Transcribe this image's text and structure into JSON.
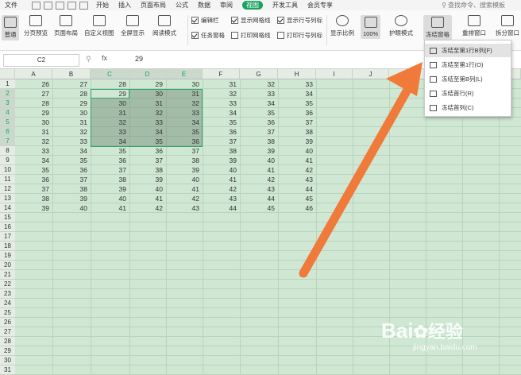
{
  "menubar": {
    "file_label": "文件",
    "tabs": [
      "开始",
      "插入",
      "页面布局",
      "公式",
      "数据",
      "审阅"
    ],
    "active_tab": "视图",
    "tabs_after": [
      "开发工具",
      "会员专享"
    ],
    "search_placeholder": "查找命令、搜索模板"
  },
  "ribbon": {
    "normal": "普通",
    "page_break_preview": "分页预览",
    "page_layout": "页面布局",
    "custom_view": "自定义视图",
    "full_screen": "全屏显示",
    "reading_mode": "阅读模式",
    "edit_bar": "编辑栏",
    "task_pane": "任务窗格",
    "show_gridlines": "显示网格线",
    "print_gridlines": "打印网格线",
    "show_headers": "显示行号列标",
    "print_headers": "打印行号列标",
    "zoom": "显示比例",
    "zoom_100": "100%",
    "eye_protection": "护眼模式",
    "freeze_panes": "冻结窗格",
    "rearrange": "重排窗口",
    "split": "拆分窗口"
  },
  "checkboxes": {
    "edit_bar": true,
    "task_pane": true,
    "show_gridlines": true,
    "print_gridlines": false,
    "show_headers": true,
    "print_headers": false
  },
  "formula_bar": {
    "name_box": "C2",
    "fx": "fx",
    "value": "29"
  },
  "columns": [
    "A",
    "B",
    "C",
    "D",
    "E",
    "F",
    "G",
    "H",
    "I",
    "J"
  ],
  "rows": [
    "1",
    "2",
    "3",
    "4",
    "5",
    "6",
    "7",
    "8",
    "9",
    "10",
    "11",
    "12",
    "13",
    "14",
    "15",
    "16",
    "17",
    "18",
    "19",
    "20",
    "21",
    "22",
    "23",
    "24",
    "25",
    "26",
    "27",
    "28",
    "29",
    "30",
    "31"
  ],
  "data": [
    [
      26,
      27,
      28,
      29,
      30,
      31,
      32,
      33
    ],
    [
      27,
      28,
      29,
      30,
      31,
      32,
      33,
      34
    ],
    [
      28,
      29,
      30,
      31,
      32,
      33,
      34,
      35
    ],
    [
      29,
      30,
      31,
      32,
      33,
      34,
      35,
      36
    ],
    [
      30,
      31,
      32,
      33,
      34,
      35,
      36,
      37
    ],
    [
      31,
      32,
      33,
      34,
      35,
      36,
      37,
      38
    ],
    [
      32,
      33,
      34,
      35,
      36,
      37,
      38,
      39
    ],
    [
      33,
      34,
      35,
      36,
      37,
      38,
      39,
      40
    ],
    [
      34,
      35,
      36,
      37,
      38,
      39,
      40,
      41
    ],
    [
      35,
      36,
      37,
      38,
      39,
      40,
      41,
      42
    ],
    [
      36,
      37,
      38,
      39,
      40,
      41,
      42,
      43
    ],
    [
      37,
      38,
      39,
      40,
      41,
      42,
      43,
      44
    ],
    [
      38,
      39,
      40,
      41,
      42,
      43,
      44,
      45
    ],
    [
      39,
      40,
      41,
      42,
      43,
      44,
      45,
      46
    ]
  ],
  "freeze_menu": {
    "items": [
      "冻结至第1行B列(F)",
      "冻结至第1行(O)",
      "冻结至第B列(L)",
      "冻结首行(R)",
      "冻结首列(C)"
    ]
  },
  "watermark": {
    "brand": "Bai",
    "brand2": "经验",
    "url": "jingyan.baidu.com"
  },
  "colors": {
    "accent": "#1aa260",
    "arrow": "#f07a3a",
    "sheet_bg": "#cfe7d3"
  }
}
